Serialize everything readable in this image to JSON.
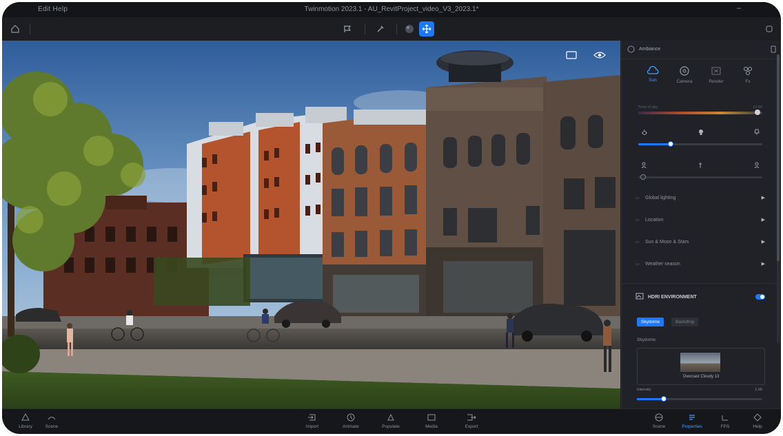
{
  "app": {
    "menu": "Edit  Help",
    "title": "Twinmotion 2023.1 - AU_RevitProject_video_V3_2023.1*",
    "minimize": "–"
  },
  "toolbar": {
    "tools": [
      "flag-icon",
      "brush-icon",
      "sphere-icon",
      "move-icon"
    ],
    "active_tool": "move-icon",
    "accent": "#1e78ff"
  },
  "panel": {
    "header": "Ambiance",
    "tabs": [
      {
        "label": "Sun",
        "icon": "cloud-icon"
      },
      {
        "label": "Camera",
        "icon": "camera-icon"
      },
      {
        "label": "Render",
        "icon": "render-icon"
      },
      {
        "label": "Fx",
        "icon": "fx-icon"
      }
    ],
    "active_tab": "Sun",
    "slider1": {
      "left": "Time of day",
      "right": "12:00",
      "value": 0.98
    },
    "slider2": {
      "value": 0.25
    },
    "slider3": {
      "value": 0.02
    },
    "sections": [
      {
        "label": "Global lighting"
      },
      {
        "label": "Location"
      },
      {
        "label": "Sun & Moon & Stars"
      },
      {
        "label": "Weather season"
      }
    ],
    "hdri": {
      "label": "HDRI ENVIRONMENT",
      "enabled": true
    },
    "modes": [
      "Skydome",
      "Backdrop"
    ],
    "active_mode": "Skydome",
    "skydome_label": "Skydome",
    "preset": "Overcast Cloudy 13",
    "intensity": {
      "label": "Intensity",
      "value": "1.00",
      "level": 0.2
    }
  },
  "bottom": {
    "left": [
      {
        "label": "Library",
        "icon": "library-icon"
      },
      {
        "label": "Scene",
        "icon": "scene-icon"
      }
    ],
    "center": [
      {
        "label": "Import",
        "icon": "import-icon"
      },
      {
        "label": "Animate",
        "icon": "animate-icon"
      },
      {
        "label": "Populate",
        "icon": "populate-icon"
      },
      {
        "label": "Media",
        "icon": "media-icon"
      },
      {
        "label": "Export",
        "icon": "export-icon"
      }
    ],
    "right": [
      {
        "label": "Scene",
        "icon": "globe-icon"
      },
      {
        "label": "Properties",
        "icon": "properties-icon"
      },
      {
        "label": "FPS",
        "icon": "fps-icon"
      },
      {
        "label": "Help",
        "icon": "help-icon"
      }
    ],
    "active": "Properties"
  }
}
